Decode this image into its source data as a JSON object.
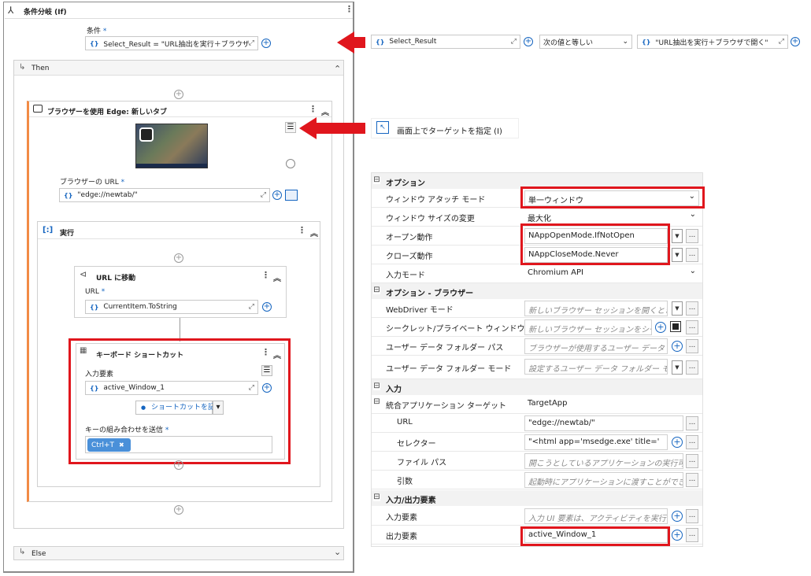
{
  "left": {
    "if_title": "条件分岐 (If)",
    "condition_label": "条件",
    "req": "*",
    "condition_value": "Select_Result = \"URL抽出を実行＋ブラウザで",
    "then_label": "Then",
    "else_label": "Else",
    "browser_title": "ブラウザーを使用 Edge: 新しいタブ",
    "browser_url_label": "ブラウザーの URL",
    "browser_url_value": "\"edge://newtab/\"",
    "exec_title": "実行",
    "nav_title": "URL に移動",
    "url_label": "URL",
    "url_value": "CurrentItem.ToString",
    "kb_title": "キーボード ショートカット",
    "input_elem_label": "入力要素",
    "input_elem_value": "active_Window_1",
    "record_label": "ショートカットを記録",
    "send_label": "キーの組み合わせを送信",
    "chip_label": "Ctrl+T",
    "chip_x": "✖"
  },
  "cond_row": {
    "left_value": "Select_Result",
    "operator": "次の値と等しい",
    "right_value": "\"URL抽出を実行＋ブラウザで開く\""
  },
  "target_menu": {
    "label": "画面上でターゲットを指定 (I)"
  },
  "props": {
    "sec_options": "オプション",
    "window_attach_label": "ウィンドウ アタッチ モード",
    "window_attach_value": "単一ウィンドウ",
    "window_resize_label": "ウィンドウ サイズの変更",
    "window_resize_value": "最大化",
    "open_label": "オープン動作",
    "open_value": "NAppOpenMode.IfNotOpen",
    "close_label": "クローズ動作",
    "close_value": "NAppCloseMode.Never",
    "input_mode_label": "入力モード",
    "input_mode_value": "Chromium API",
    "sec_options_browser": "オプション - ブラウザー",
    "webdriver_label": "WebDriver モード",
    "webdriver_value": "新しいブラウザー セッションを開くとき",
    "secret_label": "シークレット/プライベート ウィンドウ",
    "secret_value": "新しいブラウザー セッションをシー:",
    "userdata_label": "ユーザー データ フォルダー パス",
    "userdata_value": "ブラウザーが使用するユーザー データ フ",
    "userdata_mode_label": "ユーザー データ フォルダー モード",
    "userdata_mode_value": "設定するユーザー データ フォルダー モー",
    "sec_input": "入力",
    "target_app_label": "統合アプリケーション ターゲット",
    "target_app_value": "TargetApp",
    "url_label": "URL",
    "url_value": "\"edge://newtab/\"",
    "selector_label": "セレクター",
    "selector_value": "\"<html app='msedge.exe' title='",
    "filepath_label": "ファイル パス",
    "filepath_value": "開こうとしているアプリケーションの実行可",
    "args_label": "引数",
    "args_value": "起動時にアプリケーションに渡すことができ",
    "sec_io": "入力/出力要素",
    "in_elem_label": "入力要素",
    "in_elem_value": "入力 UI 要素は、アクティビティを実行",
    "out_elem_label": "出力要素",
    "out_elem_value": "active_Window_1",
    "collapse": "⊟",
    "ellipsis": "...",
    "plus": "+",
    "caret": "▼",
    "vcaret": "⌄"
  },
  "icons": {
    "add": "+",
    "dots": "⋮",
    "collapse_up": "⌃",
    "expand": "⌄",
    "expression": "⤢",
    "menu": "☰",
    "caret_down": "▾",
    "record_dot": "●",
    "return_arrow": "↳",
    "braces": "{ }",
    "curly": "{}"
  },
  "colors": {
    "accent": "#1565c0",
    "highlight": "#e0161d",
    "activity_bar": "#f28b45"
  }
}
